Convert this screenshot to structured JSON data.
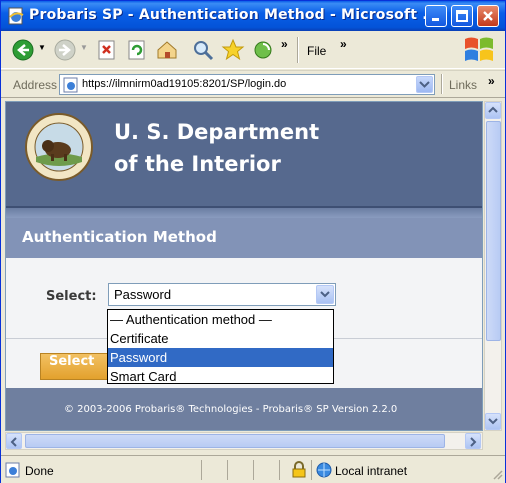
{
  "window": {
    "title": "Probaris SP - Authentication Method - Microsoft ...",
    "title_bar_color": "#0a5fe8"
  },
  "toolbar": {
    "back_icon": "back-arrow-icon",
    "forward_icon": "forward-arrow-icon",
    "overflow_1": "»",
    "file_menu": "File",
    "overflow_2": "»"
  },
  "address_bar": {
    "label": "Address",
    "url": "https://ilmnirm0ad19105:8201/SP/login.do",
    "links_label": "Links",
    "links_overflow": "»"
  },
  "page": {
    "banner": {
      "line1": "U. S. Department",
      "line2": "of the Interior",
      "color": "#56698e"
    },
    "section_heading": "Authentication Method",
    "form": {
      "select_label": "Select:",
      "select_value": "Password",
      "options": [
        "— Authentication method —",
        "Certificate",
        "Password",
        "Smart Card"
      ],
      "highlighted_option": "Password",
      "submit_button": "Select"
    },
    "footer": "© 2003-2006 Probaris® Technologies - Probaris® SP Version 2.2.0"
  },
  "status_bar": {
    "status": "Done",
    "zone": "Local intranet"
  },
  "colors": {
    "highlight": "#316ac5",
    "button": "#e3a12d",
    "section_bar": "#8293b7"
  }
}
